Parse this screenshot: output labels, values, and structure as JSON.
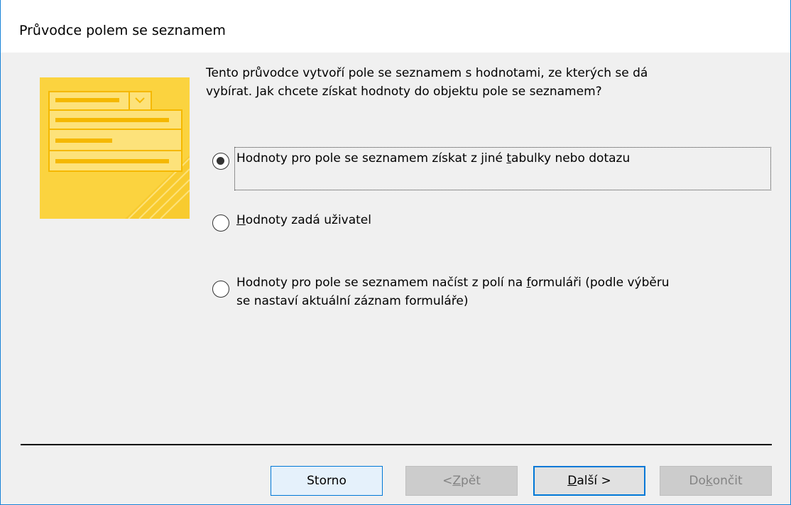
{
  "window": {
    "title": "Průvodce polem se seznamem"
  },
  "prompt": {
    "line1": "Tento průvodce vytvoří pole se seznamem s hodnotami, ze kterých se dá",
    "line2": "vybírat. Jak chcete získat hodnoty do objektu pole se seznamem?"
  },
  "options": [
    {
      "pre": "Hodnoty pro pole se seznamem získat z jiné ",
      "access": "t",
      "post": "abulky nebo dotazu",
      "line2": "",
      "checked": true
    },
    {
      "pre": "",
      "access": "H",
      "post": "odnoty zadá uživatel",
      "line2": "",
      "checked": false
    },
    {
      "pre": "Hodnoty pro pole se seznamem načíst z polí na ",
      "access": "f",
      "post": "ormuláři (podle výběru",
      "line2": "se nastaví aktuální záznam formuláře)",
      "checked": false
    }
  ],
  "buttons": {
    "cancel": "Storno",
    "back_pre": "< ",
    "back_access": "Z",
    "back_post": "pět",
    "next_pre": "",
    "next_access": "D",
    "next_post": "alší >",
    "finish_pre": "Do",
    "finish_access": "k",
    "finish_post": "ončit"
  },
  "colors": {
    "accent": "#0078d7",
    "illustration": "#fdd835"
  },
  "icons": {
    "illustration": "combo-box-illustration-icon"
  }
}
